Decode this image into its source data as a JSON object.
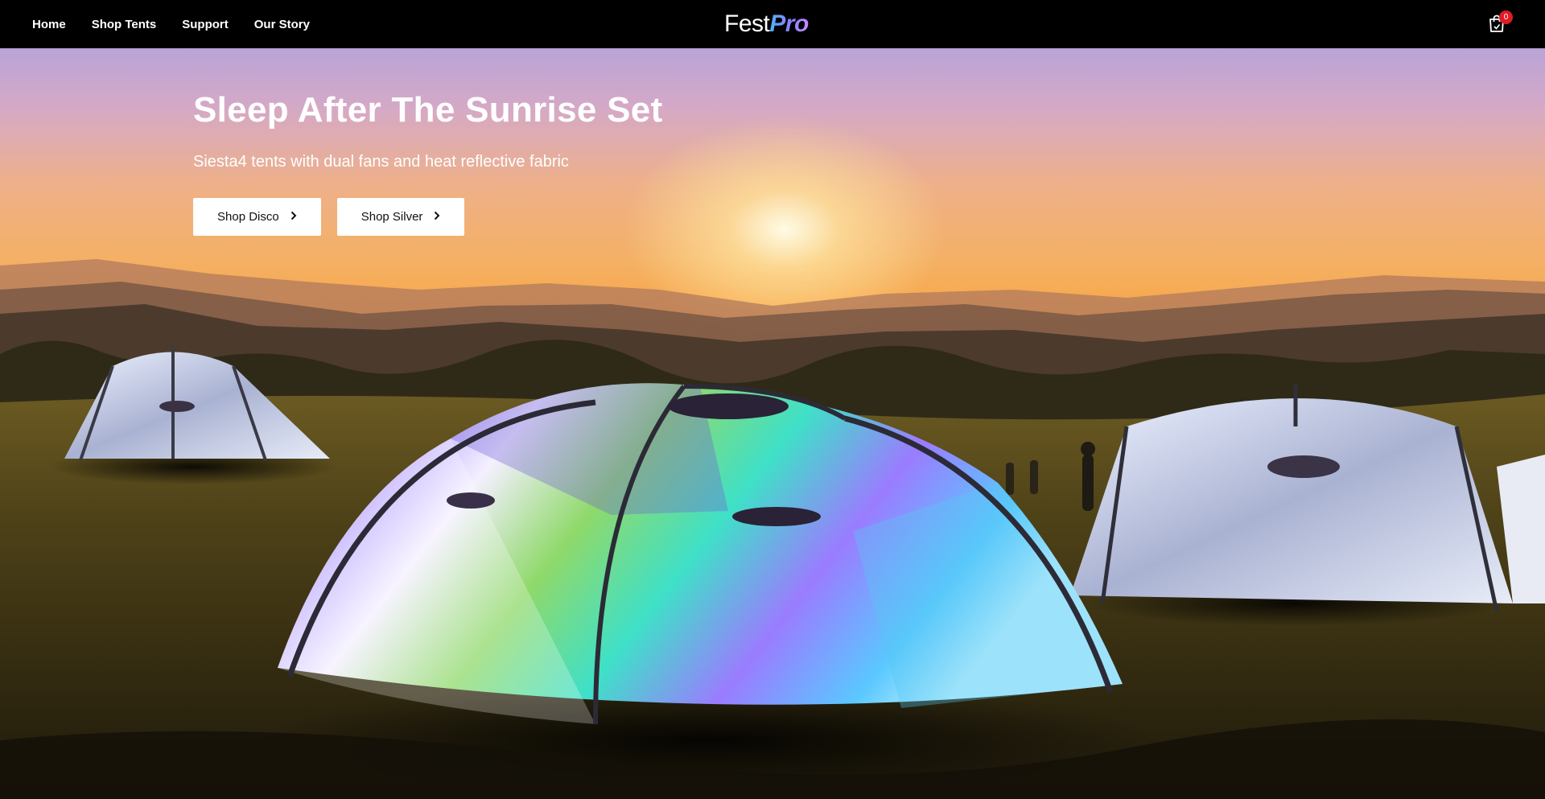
{
  "nav": {
    "items": [
      {
        "label": "Home"
      },
      {
        "label": "Shop Tents"
      },
      {
        "label": "Support"
      },
      {
        "label": "Our Story"
      }
    ]
  },
  "logo": {
    "part1": "Fest",
    "part2": "Pro"
  },
  "cart": {
    "icon": "shopping-bag-icon",
    "count": "0",
    "badge_color": "#e01b24"
  },
  "hero": {
    "title": "Sleep After The Sunrise Set",
    "subtitle": "Siesta4 tents with dual fans and heat reflective fabric",
    "buttons": [
      {
        "label": "Shop Disco",
        "icon": "chevron-right-icon"
      },
      {
        "label": "Shop Silver",
        "icon": "chevron-right-icon"
      }
    ]
  },
  "colors": {
    "header_bg": "#000000",
    "button_bg": "#ffffff",
    "button_text": "#111111"
  }
}
